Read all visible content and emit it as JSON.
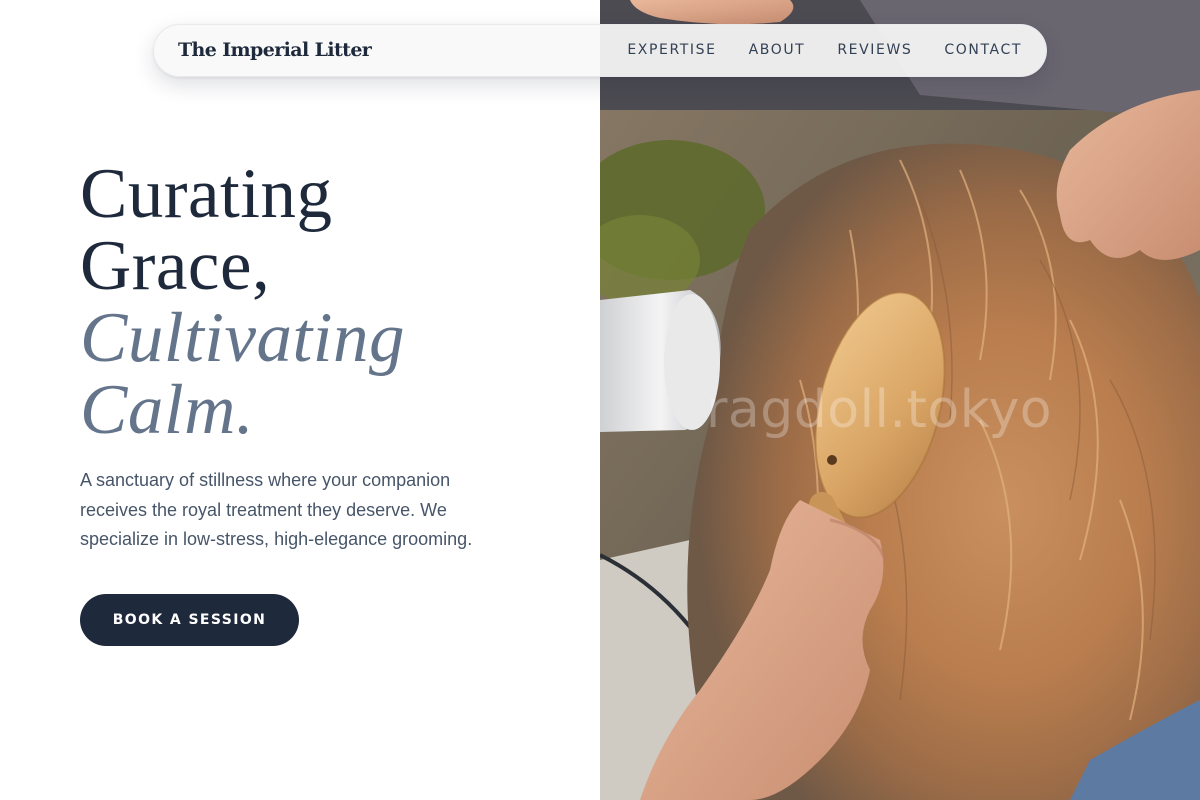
{
  "brand": {
    "name": "The Imperial Litter"
  },
  "nav": {
    "links": [
      {
        "label": "EXPERTISE"
      },
      {
        "label": "ABOUT"
      },
      {
        "label": "REVIEWS"
      },
      {
        "label": "CONTACT"
      }
    ]
  },
  "hero": {
    "headline_line1": "Curating",
    "headline_line2": "Grace,",
    "headline_line3": "Cultivating",
    "headline_line4": "Calm.",
    "description": "A sanctuary of stillness where your companion receives the royal treatment they deserve. We specialize in low-stress, high-elegance grooming.",
    "cta_label": "BOOK A SESSION"
  },
  "image": {
    "watermark": "ragdoll.tokyo",
    "subject": "hands-brushing-long-haired-cat"
  },
  "colors": {
    "primary": "#1e293b",
    "accent_italic": "#64748b",
    "body_text": "#475569",
    "background": "#ffffff"
  }
}
